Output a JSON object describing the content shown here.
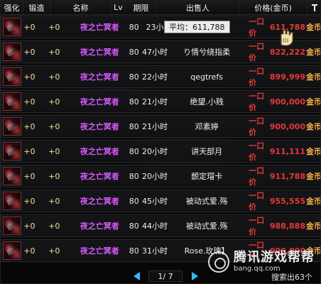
{
  "header": {
    "strength": "强化",
    "forge": "锻造",
    "name": "名称",
    "lv": "Lv",
    "term": "期限",
    "seller": "出售人",
    "price": "价格(金币)",
    "sort_icon": "sort-icon"
  },
  "tooltip": {
    "text": "平均：611,788"
  },
  "rows": [
    {
      "strength": "+0",
      "forge": "+0",
      "name": "夜之亡冥者",
      "lv": "80",
      "term": "23小",
      "seller": "",
      "label": "一口价",
      "price": "611,788",
      "currency": "金币"
    },
    {
      "strength": "+0",
      "forge": "+0",
      "name": "夜之亡冥者",
      "lv": "80",
      "term": "47小时",
      "seller": "り情兮绕指柔",
      "label": "一口价",
      "price": "822,222",
      "currency": "金币"
    },
    {
      "strength": "+0",
      "forge": "+0",
      "name": "夜之亡冥者",
      "lv": "80",
      "term": "22小时",
      "seller": "qegtrefs",
      "label": "一口价",
      "price": "899,999",
      "currency": "金币"
    },
    {
      "strength": "+0",
      "forge": "+0",
      "name": "夜之亡冥者",
      "lv": "80",
      "term": "21小时",
      "seller": "绝望.小贱",
      "label": "一口价",
      "price": "900,000",
      "currency": "金币"
    },
    {
      "strength": "+0",
      "forge": "+0",
      "name": "夜之亡冥者",
      "lv": "80",
      "term": "21小时",
      "seller": "邓素婷",
      "label": "一口价",
      "price": "900,000",
      "currency": "金币"
    },
    {
      "strength": "+0",
      "forge": "+0",
      "name": "夜之亡冥者",
      "lv": "80",
      "term": "20小时",
      "seller": "讲天部月",
      "label": "一口价",
      "price": "911,111",
      "currency": "金币"
    },
    {
      "strength": "+0",
      "forge": "+0",
      "name": "夜之亡冥者",
      "lv": "80",
      "term": "20小时",
      "seller": "颤定瑁卡",
      "label": "一口价",
      "price": "911,788",
      "currency": "金币"
    },
    {
      "strength": "+0",
      "forge": "+0",
      "name": "夜之亡冥者",
      "lv": "80",
      "term": "45小时",
      "seller": "被动式爱.殇",
      "label": "一口价",
      "price": "955,555",
      "currency": "金币"
    },
    {
      "strength": "+0",
      "forge": "+0",
      "name": "夜之亡冥者",
      "lv": "80",
      "term": "44小时",
      "seller": "被动式爱.殇",
      "label": "一口价",
      "price": "988,888",
      "currency": "金币"
    },
    {
      "strength": "+0",
      "forge": "+0",
      "name": "夜之亡冥者",
      "lv": "80",
      "term": "31小时",
      "seller": "Rose.玫瑰】",
      "label": "一口价",
      "price": "990,000",
      "currency": "金币"
    }
  ],
  "pager": {
    "current": "1",
    "total": "7",
    "text": "1/ 7",
    "prev_icon": "left-triangle-icon",
    "next_icon": "right-triangle-icon"
  },
  "search_count": "搜索出63个",
  "watermark": {
    "main": "腾讯游戏帮帮",
    "sub": "bang.qq.com",
    "logo_icon": "swirl-logo-icon"
  },
  "colors": {
    "gold": "#f4e08f",
    "purple": "#d85bff",
    "red": "#e23a3a",
    "orange": "#ffb14a",
    "blue": "#37b9ff"
  }
}
